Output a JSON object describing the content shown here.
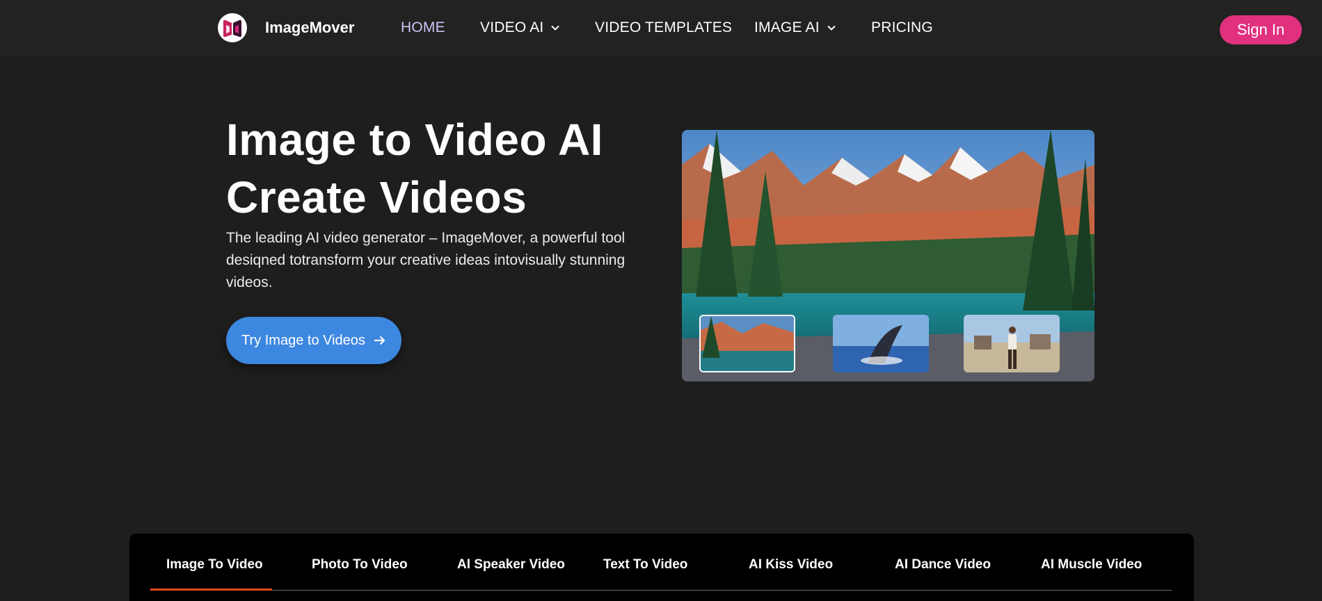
{
  "nav": {
    "brand": "ImageMover",
    "links": [
      {
        "label": "HOME",
        "active": true,
        "dropdown": false
      },
      {
        "label": "VIDEO AI",
        "active": false,
        "dropdown": true
      },
      {
        "label": "VIDEO TEMPLATES",
        "active": false,
        "dropdown": false
      },
      {
        "label": "IMAGE AI",
        "active": false,
        "dropdown": true
      },
      {
        "label": "PRICING",
        "active": false,
        "dropdown": false
      }
    ],
    "signin_label": "Sign In"
  },
  "hero": {
    "title_line1": "Image to Video AI",
    "title_line2": "Create Videos",
    "description": "The leading AI video generator – ImageMover, a powerful tool desiqned totransform your creative ideas intovisually stunning videos.",
    "cta_label": "Try Image to Videos",
    "cta_icon": "arrow-right-icon"
  },
  "tabs": {
    "items": [
      {
        "label": "Image To Video",
        "active": true
      },
      {
        "label": "Photo To Video",
        "active": false
      },
      {
        "label": "AI Speaker Video",
        "active": false
      },
      {
        "label": "Text To Video",
        "active": false
      },
      {
        "label": "AI Kiss Video",
        "active": false
      },
      {
        "label": "AI Dance Video",
        "active": false
      },
      {
        "label": "AI Muscle Video",
        "active": false
      }
    ]
  },
  "colors": {
    "background": "#1e1e1e",
    "nav_background": "#222222",
    "signin_button": "#e0307e",
    "cta_button": "#3c87e0",
    "active_nav": "#c9c6f5",
    "active_tab_underline": "#e5481f"
  }
}
